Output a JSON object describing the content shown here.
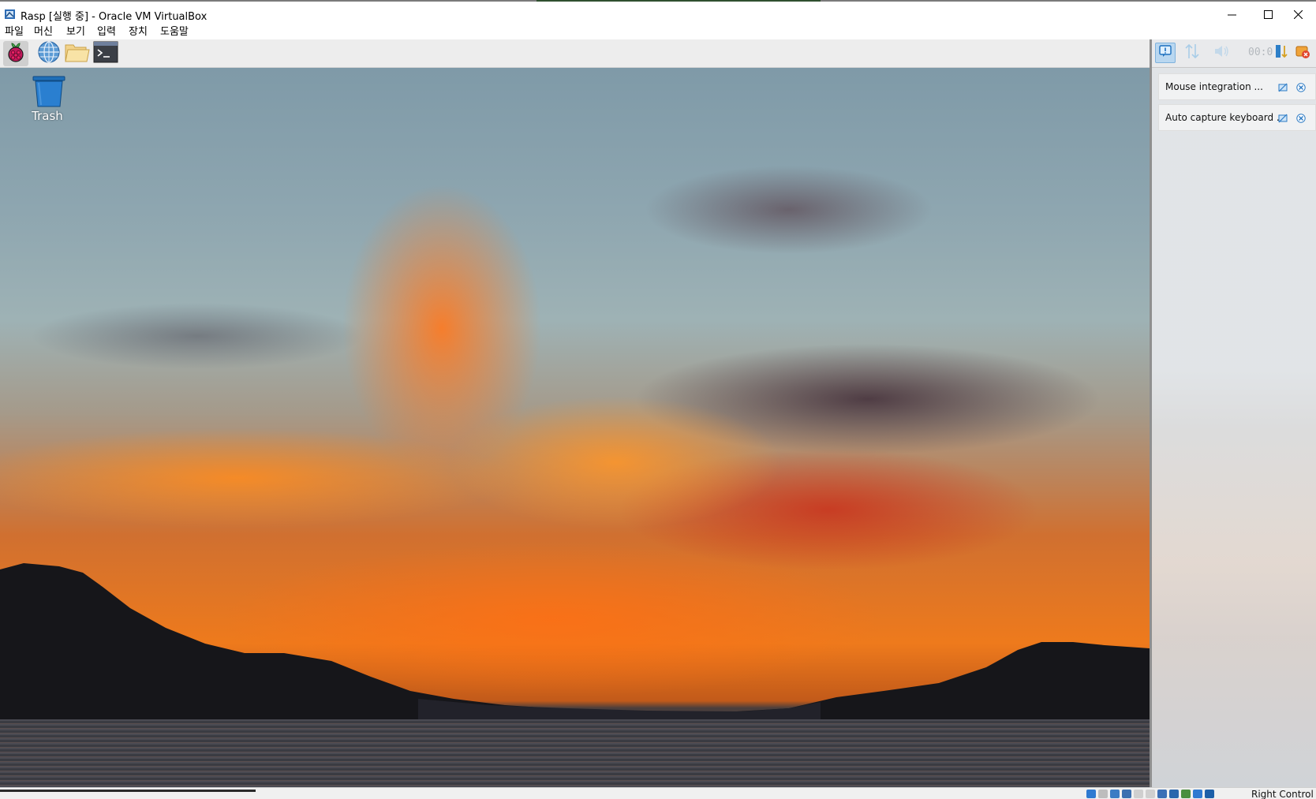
{
  "window": {
    "title": "Rasp [실행 중] - Oracle VM VirtualBox",
    "minimize_icon": "minimize-icon",
    "maximize_icon": "maximize-icon",
    "close_icon": "close-icon"
  },
  "menubar": {
    "items": [
      "파일",
      "머신",
      "보기",
      "입력",
      "장치",
      "도움말"
    ]
  },
  "guest": {
    "taskbar": {
      "buttons": [
        {
          "icon": "raspberry-menu-icon",
          "active": true
        },
        {
          "icon": "web-browser-icon"
        },
        {
          "icon": "file-manager-icon"
        },
        {
          "icon": "terminal-icon"
        }
      ]
    },
    "desktop": {
      "icons": [
        {
          "label": "Trash",
          "icon": "trash-icon"
        }
      ],
      "wallpaper": "sunset over lake with mountains"
    }
  },
  "vbox_panel": {
    "toolbar": {
      "time": "00:0",
      "icons": [
        "notification-center-icon",
        "sort-icon",
        "sound-icon",
        "toggle-sort-icon",
        "keep-finished-icon"
      ]
    },
    "notifications": [
      {
        "text": "Mouse integration ..."
      },
      {
        "text": "Auto capture keyboard ..."
      }
    ]
  },
  "statusbar": {
    "host_key": "Right Control"
  },
  "colors": {
    "selection": "#b9d7f0",
    "trash": "#1f6fb8",
    "accent_sunset": "#ee7a1c"
  }
}
